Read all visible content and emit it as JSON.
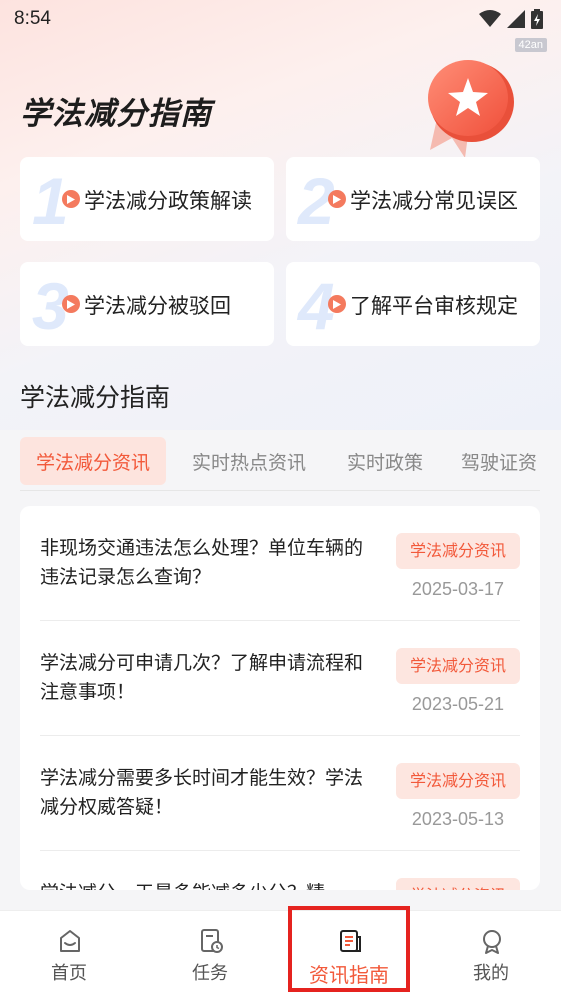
{
  "status_bar": {
    "time": "8:54",
    "badge": "42an",
    "icons": [
      "wifi-icon",
      "signal-icon",
      "battery-charging-icon"
    ]
  },
  "hero": {
    "title": "学法减分指南"
  },
  "guide_cards": [
    {
      "number": "1",
      "label": "学法减分政策解读"
    },
    {
      "number": "2",
      "label": "学法减分常见误区"
    },
    {
      "number": "3",
      "label": "学法减分被驳回"
    },
    {
      "number": "4",
      "label": "了解平台审核规定"
    }
  ],
  "section": {
    "title": "学法减分指南"
  },
  "tabs": [
    {
      "label": "学法减分资讯",
      "active": true
    },
    {
      "label": "实时热点资讯",
      "active": false
    },
    {
      "label": "实时政策",
      "active": false
    },
    {
      "label": "驾驶证资",
      "active": false
    }
  ],
  "articles": [
    {
      "title": "非现场交通违法怎么处理？单位车辆的违法记录怎么查询？",
      "tag": "学法减分资讯",
      "date": "2025-03-17"
    },
    {
      "title": "学法减分可申请几次？了解申请流程和注意事项！",
      "tag": "学法减分资讯",
      "date": "2023-05-21"
    },
    {
      "title": "学法减分需要多长时间才能生效？学法减分权威答疑！",
      "tag": "学法减分资讯",
      "date": "2023-05-13"
    },
    {
      "title": "学法减分一天最多能减多少分？精",
      "tag": "学法减分资讯",
      "date": ""
    }
  ],
  "bottom_nav": [
    {
      "label": "首页",
      "icon": "home-icon",
      "active": false
    },
    {
      "label": "任务",
      "icon": "task-icon",
      "active": false
    },
    {
      "label": "资讯指南",
      "icon": "news-icon",
      "active": true
    },
    {
      "label": "我的",
      "icon": "profile-icon",
      "active": false
    }
  ],
  "colors": {
    "accent": "#f2593a",
    "tag_bg": "#fde6e0",
    "highlight": "#e5231f"
  }
}
